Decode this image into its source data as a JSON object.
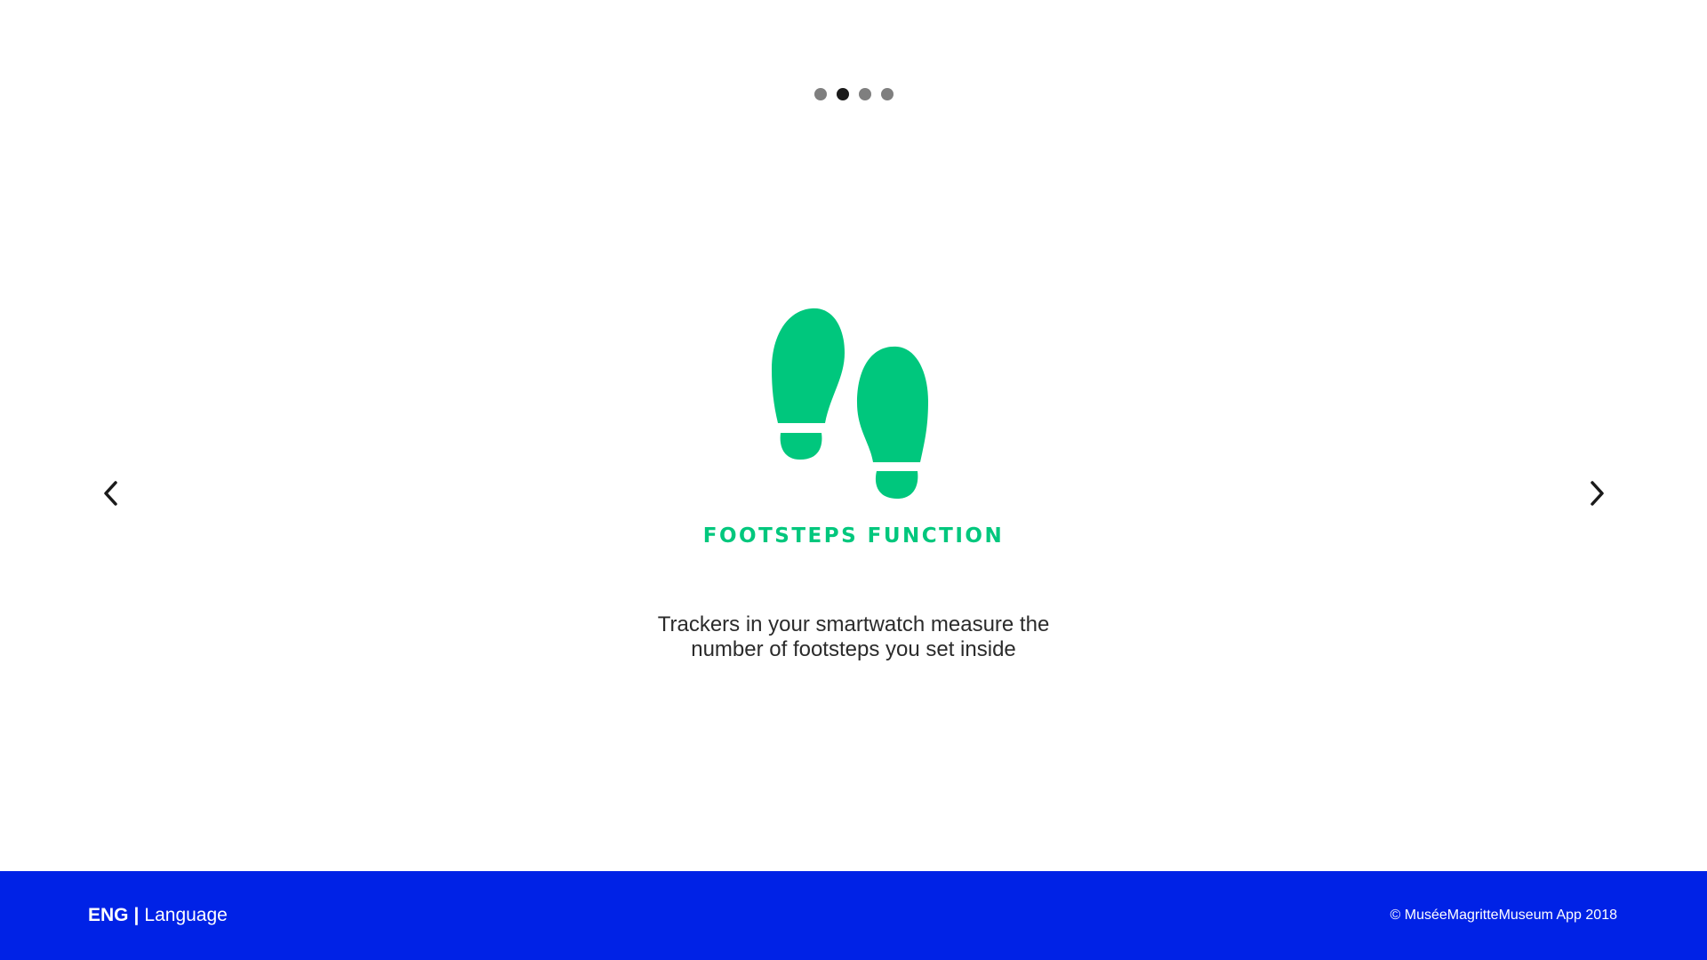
{
  "pager": {
    "count": 4,
    "active_index": 1
  },
  "navigation": {
    "prev_icon": "chevron-left-icon",
    "next_icon": "chevron-right-icon"
  },
  "feature": {
    "icon": "footsteps-icon",
    "icon_color": "#00c77d",
    "title": "FOOTSTEPS FUNCTION",
    "description_line1": "Trackers in your smartwatch measure the",
    "description_line2": "number of footsteps you set inside"
  },
  "footer": {
    "background": "#0022e6",
    "lang_code": "ENG",
    "lang_separator": "|",
    "lang_label": "Language",
    "copyright": "© MuséeMagritteMuseum App 2018"
  }
}
